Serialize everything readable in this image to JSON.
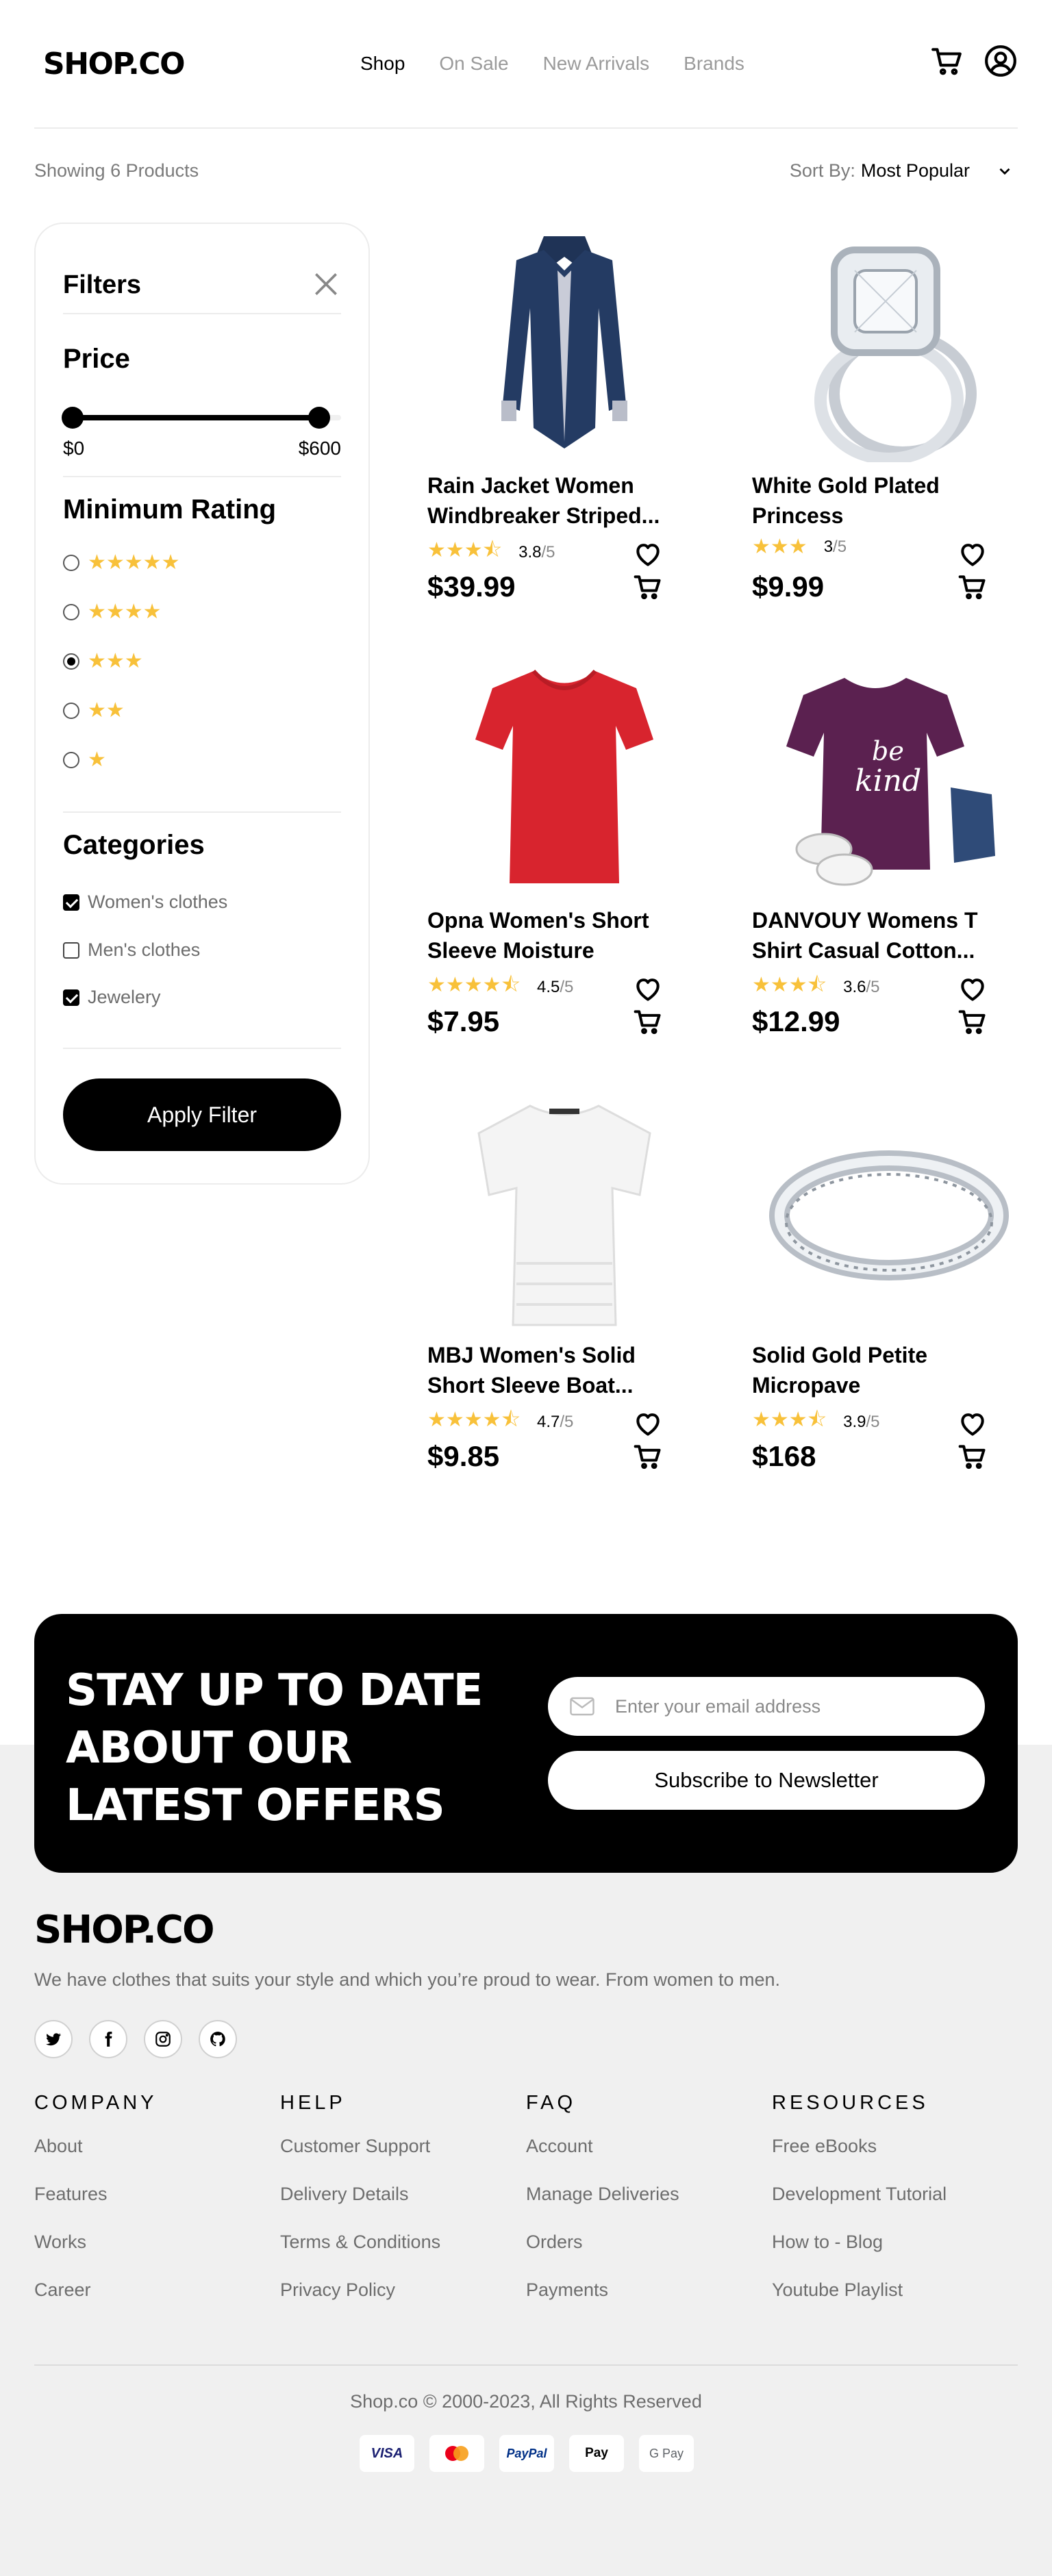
{
  "header": {
    "logo": "SHOP.CO",
    "nav": [
      {
        "label": "Shop",
        "active": true
      },
      {
        "label": "On Sale",
        "active": false
      },
      {
        "label": "New Arrivals",
        "active": false
      },
      {
        "label": "Brands",
        "active": false
      }
    ],
    "icons": [
      "cart-icon",
      "user-icon"
    ]
  },
  "listing": {
    "showing": "Showing 6 Products",
    "sort_label": "Sort By:",
    "sort_value": "Most Popular"
  },
  "filters": {
    "title": "Filters",
    "price": {
      "title": "Price",
      "min": "$0",
      "max": "$600",
      "range_fraction": [
        0,
        0.91
      ]
    },
    "rating": {
      "title": "Minimum Rating",
      "options": [
        {
          "stars": "★★★★★",
          "selected": false
        },
        {
          "stars": "★★★★",
          "selected": false
        },
        {
          "stars": "★★★",
          "selected": true
        },
        {
          "stars": "★★",
          "selected": false
        },
        {
          "stars": "★",
          "selected": false
        }
      ]
    },
    "categories": {
      "title": "Categories",
      "items": [
        {
          "label": "Women's clothes",
          "checked": true
        },
        {
          "label": "Men's clothes",
          "checked": false
        },
        {
          "label": "Jewelery",
          "checked": true
        }
      ]
    },
    "apply_label": "Apply Filter"
  },
  "products": [
    {
      "name": "Rain Jacket Women Windbreaker Striped...",
      "rating": "3.8",
      "max": "/5",
      "price": "$39.99",
      "stars": 3.8,
      "image": "jacket"
    },
    {
      "name": "White Gold Plated Princess",
      "rating": "3",
      "max": "/5",
      "price": "$9.99",
      "stars": 3,
      "image": "ring"
    },
    {
      "name": "Opna Women's Short Sleeve Moisture",
      "rating": "4.5",
      "max": "/5",
      "price": "$7.95",
      "stars": 4.5,
      "image": "red-tee"
    },
    {
      "name": "DANVOUY Womens T Shirt Casual Cotton...",
      "rating": "3.6",
      "max": "/5",
      "price": "$12.99",
      "stars": 3.6,
      "image": "purple-tee"
    },
    {
      "name": "MBJ Women's Solid Short Sleeve Boat...",
      "rating": "4.7",
      "max": "/5",
      "price": "$9.85",
      "stars": 4.7,
      "image": "white-tee"
    },
    {
      "name": "Solid Gold Petite Micropave",
      "rating": "3.9",
      "max": "/5",
      "price": "$168",
      "stars": 3.9,
      "image": "band"
    }
  ],
  "newsletter": {
    "title": "STAY UP TO DATE ABOUT OUR LATEST OFFERS",
    "email_placeholder": "Enter your email address",
    "subscribe_label": "Subscribe to Newsletter"
  },
  "footer": {
    "logo": "SHOP.CO",
    "description": "We have clothes that suits your style and which you’re proud to wear. From women to men.",
    "socials": [
      "twitter-icon",
      "facebook-icon",
      "instagram-icon",
      "github-icon"
    ],
    "columns": [
      {
        "title": "COMPANY",
        "links": [
          "About",
          "Features",
          "Works",
          "Career"
        ]
      },
      {
        "title": "HELP",
        "links": [
          "Customer Support",
          "Delivery Details",
          "Terms & Conditions",
          "Privacy Policy"
        ]
      },
      {
        "title": "FAQ",
        "links": [
          "Account",
          "Manage Deliveries",
          "Orders",
          "Payments"
        ]
      },
      {
        "title": "RESOURCES",
        "links": [
          "Free eBooks",
          "Development Tutorial",
          "How to - Blog",
          "Youtube Playlist"
        ]
      }
    ],
    "copyright": "Shop.co © 2000-2023, All Rights Reserved",
    "payments": [
      {
        "label": "VISA",
        "color": "#1a1f71"
      },
      {
        "label": "",
        "color": "#eb001b"
      },
      {
        "label": "PayPal",
        "color": "#003087"
      },
      {
        "label": "Pay",
        "color": "#000000"
      },
      {
        "label": "G Pay",
        "color": "#5f6368"
      }
    ]
  }
}
